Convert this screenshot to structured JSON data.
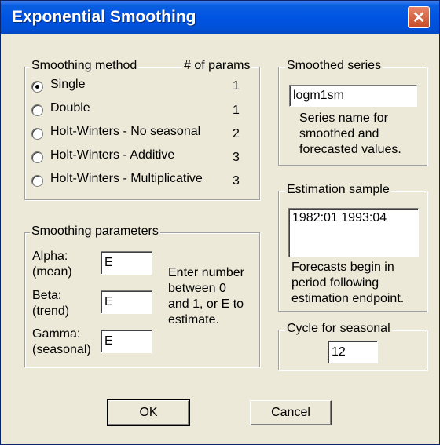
{
  "window": {
    "title": "Exponential Smoothing",
    "close_glyph": "✕"
  },
  "smoothing_method": {
    "legend": "Smoothing method",
    "params_header": "# of params",
    "options": [
      {
        "label": "Single",
        "params": "1",
        "checked": true
      },
      {
        "label": "Double",
        "params": "1",
        "checked": false
      },
      {
        "label": "Holt-Winters - No seasonal",
        "params": "2",
        "checked": false
      },
      {
        "label": "Holt-Winters - Additive",
        "params": "3",
        "checked": false
      },
      {
        "label": "Holt-Winters - Multiplicative",
        "params": "3",
        "checked": false
      }
    ]
  },
  "smoothed_series": {
    "legend": "Smoothed series",
    "value": "logm1sm",
    "note_lines": [
      "Series name for",
      "smoothed and",
      "forecasted values."
    ]
  },
  "estimation_sample": {
    "legend": "Estimation sample",
    "value": "1982:01 1993:04",
    "note_lines": [
      "Forecasts begin in",
      "period following",
      "estimation endpoint."
    ]
  },
  "smoothing_parameters": {
    "legend": "Smoothing parameters",
    "alpha": {
      "label_lines": [
        "Alpha:",
        "(mean)"
      ],
      "value": "E"
    },
    "beta": {
      "label_lines": [
        "Beta:",
        "(trend)"
      ],
      "value": "E"
    },
    "gamma": {
      "label_lines": [
        "Gamma:",
        "(seasonal)"
      ],
      "value": "E"
    },
    "hint_lines": [
      "Enter number",
      "between  0",
      "and 1, or E to",
      "estimate."
    ]
  },
  "cycle_for_seasonal": {
    "legend": "Cycle for seasonal",
    "value": "12"
  },
  "buttons": {
    "ok": "OK",
    "cancel": "Cancel"
  }
}
